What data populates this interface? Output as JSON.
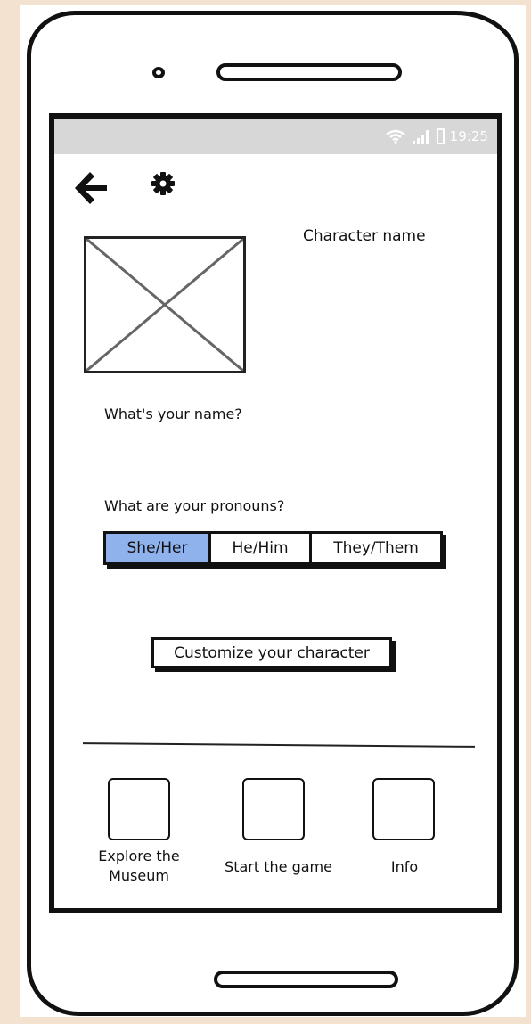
{
  "status_bar": {
    "time": "19:25",
    "icons": [
      "wifi-icon",
      "signal-icon",
      "battery-icon"
    ]
  },
  "toolbar": {
    "back_icon": "back-arrow-icon",
    "settings_icon": "gear-icon"
  },
  "profile": {
    "character_name_label": "Character name",
    "name_question": "What's your name?",
    "pronouns_question": "What are your pronouns?",
    "pronoun_options": [
      "She/Her",
      "He/Him",
      "They/Them"
    ],
    "selected_pronoun": "She/Her",
    "customize_button": "Customize your character"
  },
  "bottom_nav": {
    "items": [
      {
        "label": "Explore the Museum"
      },
      {
        "label": "Start the game"
      },
      {
        "label": "Info"
      }
    ]
  },
  "colors": {
    "background": "#f3e2cf",
    "status_bar": "#d7d7d7",
    "selected_segment": "#8fb1ec"
  }
}
